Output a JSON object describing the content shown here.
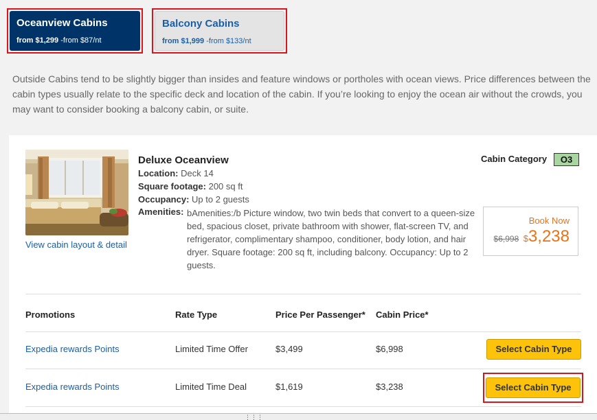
{
  "tabs": [
    {
      "title": "Oceanview Cabins",
      "from_price": "from $1,299",
      "per_night": "-from $87/nt",
      "active": true
    },
    {
      "title": "Balcony Cabins",
      "from_price": "from $1,999",
      "per_night": "-from $133/nt",
      "active": false
    }
  ],
  "intro_text": "Outside Cabins tend to be slightly bigger than insides and feature windows or portholes with ocean views. Price differences between the cabin types usually relate to the specific deck and location of the cabin. If you’re looking to enjoy the ocean air without the crowds, you may want to consider booking a balcony cabin, or suite.",
  "cabin": {
    "name": "Deluxe Oceanview",
    "view_link": "View cabin layout & detail",
    "location_label": "Location:",
    "location_value": "Deck 14",
    "sqft_label": "Square footage:",
    "sqft_value": "200 sq ft",
    "occupancy_label": "Occupancy:",
    "occupancy_value": "Up to 2 guests",
    "amenities_label": "Amenities:",
    "amenities_value": "bAmenities:/b Picture window, two twin beds that convert to a queen-size bed, spacious closet, private bathroom with shower, flat-screen TV, and refrigerator, complimentary shampoo, conditioner, body lotion, and hair dryer. Square footage: 200 sq ft, including balcony. Occupancy: Up to 2 guests.",
    "category_label": "Cabin Category",
    "category_code": "O3",
    "book_now": "Book Now",
    "old_price": "$6,998",
    "currency": "$",
    "new_price": "3,238"
  },
  "table": {
    "headers": [
      "Promotions",
      "Rate Type",
      "Price Per Passenger*",
      "Cabin Price*"
    ],
    "rows": [
      {
        "promotion": "Expedia rewards Points",
        "rate_type": "Limited Time Offer",
        "per_passenger": "$3,499",
        "cabin_price": "$6,998",
        "button": "Select Cabin Type"
      },
      {
        "promotion": "Expedia rewards Points",
        "rate_type": "Limited Time Deal",
        "per_passenger": "$1,619",
        "cabin_price": "$3,238",
        "button": "Select Cabin Type"
      }
    ]
  },
  "colors": {
    "active_tab": "#003468",
    "accent_orange": "#e8731b",
    "button_yellow": "#fcc30a",
    "highlight_red": "#d9141b",
    "category_badge": "#a8d5a0"
  }
}
